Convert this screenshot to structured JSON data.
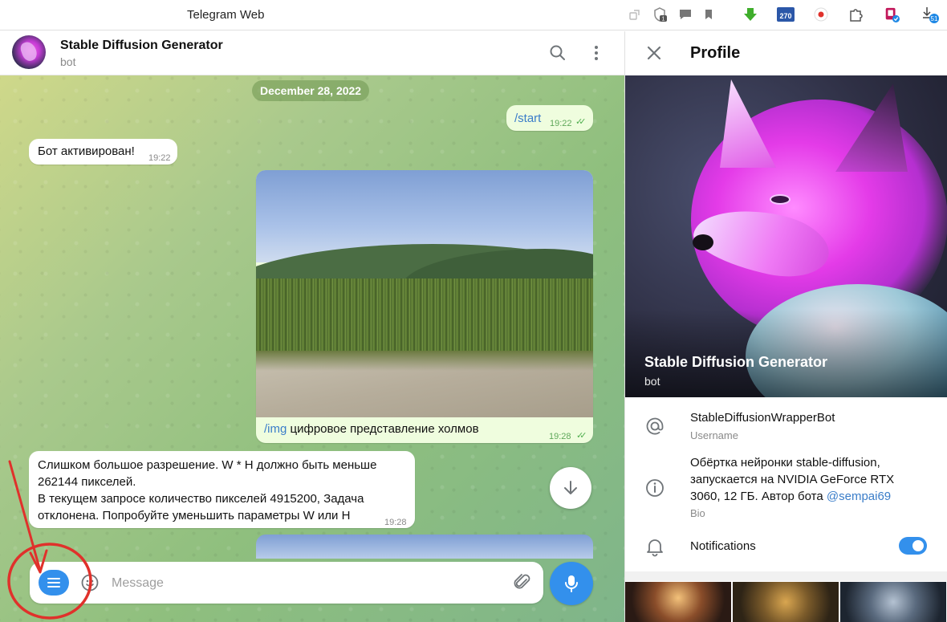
{
  "browser": {
    "title": "Telegram Web",
    "badges": {
      "extension_count": "270",
      "download_count": "51",
      "notif_count": "1"
    }
  },
  "chat": {
    "title": "Stable Diffusion Generator",
    "subtitle": "bot",
    "date_pill": "December 28, 2022",
    "messages": [
      {
        "dir": "out",
        "command": "/start",
        "time": "19:22",
        "read": true
      },
      {
        "dir": "in",
        "text": "Бот активирован!",
        "time": "19:22"
      },
      {
        "dir": "out",
        "type": "photo",
        "command": "/img",
        "caption": " цифровое представление холмов",
        "time": "19:28",
        "read": true
      },
      {
        "dir": "in",
        "lines": [
          "Слишком большое разрешение. W * H должно быть меньше",
          "262144 пикселей.",
          "В текущем запросе количество пикселей 4915200, Задача",
          "отклонена. Попробуйте уменьшить параметры W или H"
        ],
        "time": "19:28"
      }
    ],
    "composer": {
      "placeholder": "Message"
    }
  },
  "profile": {
    "title": "Profile",
    "name": "Stable Diffusion Generator",
    "sub": "bot",
    "username": "StableDiffusionWrapperBot",
    "username_label": "Username",
    "bio_lines": [
      "Обёртка нейронки stable-diffusion,",
      "запускается на NVIDIA GeForce RTX",
      "3060, 12 ГБ. Автор бота "
    ],
    "bio_link": "@sempai69",
    "bio_label": "Bio",
    "notifications_label": "Notifications",
    "notifications_on": true
  },
  "colors": {
    "accent": "#3390ec",
    "outgoing_bubble": "#effdde",
    "annotation": "#e0312b"
  },
  "icons": [
    "search-icon",
    "more-vertical-icon",
    "close-icon",
    "at-icon",
    "info-icon",
    "bell-icon",
    "menu-icon",
    "emoji-icon",
    "attach-icon",
    "mic-icon",
    "arrow-down-icon"
  ]
}
